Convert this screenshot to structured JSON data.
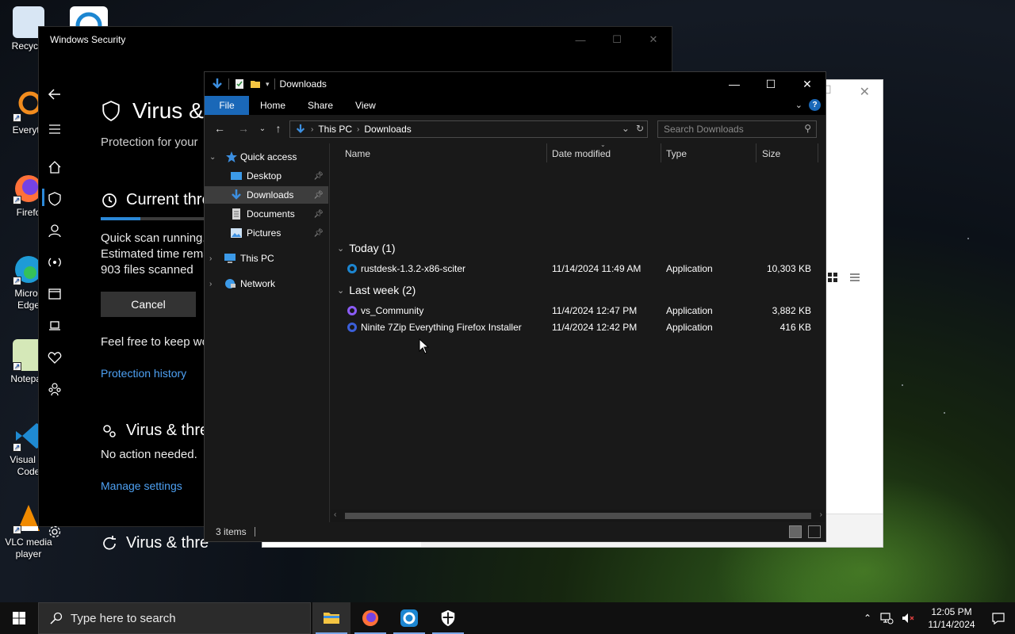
{
  "desktop": {
    "icons": [
      {
        "label": "Recycle",
        "color": "#a7c6e8"
      },
      {
        "label": "Everyth",
        "color": "#f28c1e"
      },
      {
        "label": "Firefo",
        "color": "#ff7139"
      },
      {
        "label": "Micros Edge",
        "color": "#1e9bd7"
      },
      {
        "label": "Notepad",
        "color": "#8fd14f"
      },
      {
        "label": "Visual St Code",
        "color": "#1f8ad2"
      },
      {
        "label": "VLC media player",
        "color": "#f08a00"
      }
    ]
  },
  "security": {
    "window_title": "Windows Security",
    "heading": "Virus &",
    "subtitle": "Protection for your",
    "current_threats": "Current thre",
    "scan_status": "Quick scan running.",
    "estimated": "Estimated time rema",
    "files_scanned": "903  files scanned",
    "scan_progress_percent": 36,
    "cancel_label": "Cancel",
    "keep_working": "Feel free to keep wo",
    "protection_history": "Protection history",
    "settings_heading": "Virus & thre",
    "no_action": "No action needed.",
    "manage_settings": "Manage settings",
    "updates_heading": "Virus & thre"
  },
  "explorer": {
    "title": "Downloads",
    "ribbon_tabs": [
      "File",
      "Home",
      "Share",
      "View"
    ],
    "breadcrumb": [
      "This PC",
      "Downloads"
    ],
    "search_placeholder": "Search Downloads",
    "nav": {
      "quick_access": "Quick access",
      "desktop": "Desktop",
      "downloads": "Downloads",
      "documents": "Documents",
      "pictures": "Pictures",
      "this_pc": "This PC",
      "network": "Network"
    },
    "columns": {
      "name": "Name",
      "date": "Date modified",
      "type": "Type",
      "size": "Size"
    },
    "groups": [
      {
        "label": "Today (1)",
        "files": [
          {
            "name": "rustdesk-1.3.2-x86-sciter",
            "date": "11/14/2024 11:49 AM",
            "type": "Application",
            "size": "10,303 KB"
          }
        ]
      },
      {
        "label": "Last week (2)",
        "files": [
          {
            "name": "vs_Community",
            "date": "11/4/2024 12:47 PM",
            "type": "Application",
            "size": "3,882 KB"
          },
          {
            "name": "Ninite 7Zip Everything Firefox Installer",
            "date": "11/4/2024 12:42 PM",
            "type": "Application",
            "size": "416 KB"
          }
        ]
      }
    ],
    "status_items": "3 items"
  },
  "taskbar": {
    "search_placeholder": "Type here to search",
    "time": "12:05 PM",
    "date": "11/14/2024"
  },
  "colors": {
    "accent": "#1a68b8",
    "link": "#4ea1f3"
  }
}
